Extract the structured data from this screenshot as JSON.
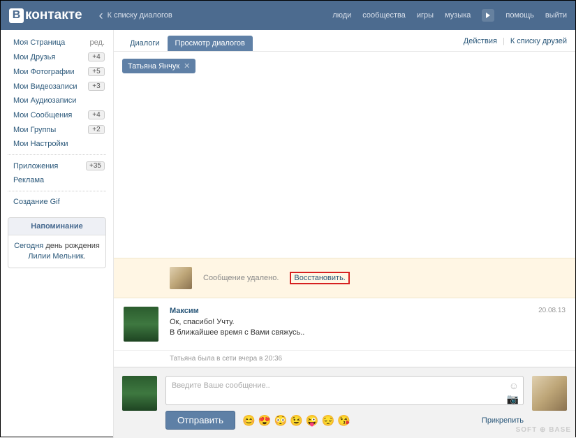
{
  "topbar": {
    "logo_text": "контакте",
    "back": "К списку диалогов",
    "nav": [
      "люди",
      "сообщества",
      "игры",
      "музыка"
    ],
    "help": "помощь",
    "logout": "выйти"
  },
  "sidebar": {
    "edit": "ред.",
    "items": [
      {
        "label": "Моя Страница",
        "badge": ""
      },
      {
        "label": "Мои Друзья",
        "badge": "+4"
      },
      {
        "label": "Мои Фотографии",
        "badge": "+5"
      },
      {
        "label": "Мои Видеозаписи",
        "badge": "+3"
      },
      {
        "label": "Мои Аудиозаписи",
        "badge": ""
      },
      {
        "label": "Мои Сообщения",
        "badge": "+4"
      },
      {
        "label": "Мои Группы",
        "badge": "+2"
      },
      {
        "label": "Мои Настройки",
        "badge": ""
      }
    ],
    "items2": [
      {
        "label": "Приложения",
        "badge": "+35"
      },
      {
        "label": "Реклама",
        "badge": ""
      }
    ],
    "items3": [
      {
        "label": "Создание Gif",
        "badge": ""
      }
    ]
  },
  "reminder": {
    "title": "Напоминание",
    "line1": "Сегодня",
    "line2": "день рождения",
    "name": "Лилии Мельник",
    "dot": "."
  },
  "tabs": {
    "t1": "Диалоги",
    "t2": "Просмотр диалогов",
    "actions": "Действия",
    "friends": "К списку друзей"
  },
  "chip": {
    "name": "Татьяна Янчук"
  },
  "deleted": {
    "text": "Сообщение удалено.",
    "restore": "Восстановить."
  },
  "msg": {
    "author": "Максим",
    "date": "20.08.13",
    "l1": "Ок, спасибо! Учту.",
    "l2": "В ближайшее время с Вами свяжусь.."
  },
  "last_seen": "Татьяна была в сети вчера в 20:36",
  "composer": {
    "placeholder": "Введите Ваше сообщение..",
    "send": "Отправить",
    "attach": "Прикрепить"
  },
  "watermark": "SOFT ⊕ BASE"
}
